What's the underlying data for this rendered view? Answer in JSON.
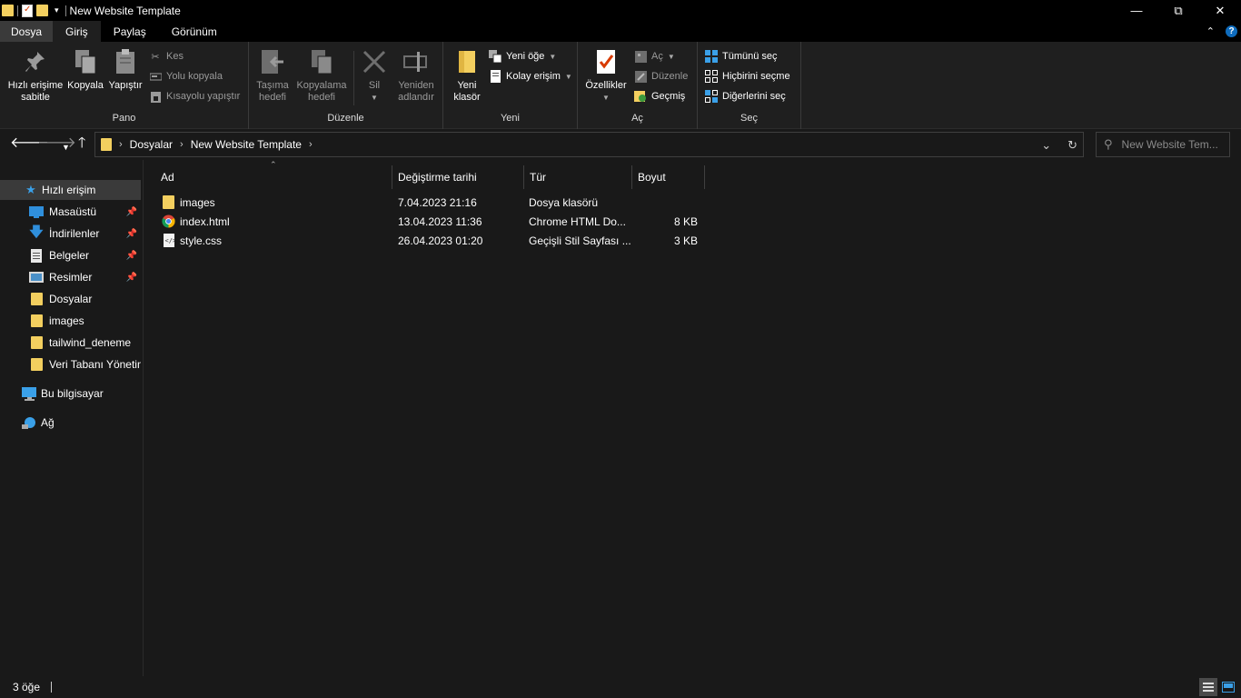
{
  "window": {
    "title": "New Website Template"
  },
  "ribbon_tabs": [
    "Dosya",
    "Giriş",
    "Paylaş",
    "Görünüm"
  ],
  "ribbon": {
    "pano": {
      "label": "Pano",
      "pin": "Hızlı erişime sabitle",
      "copy": "Kopyala",
      "paste": "Yapıştır",
      "cut": "Kes",
      "copy_path": "Yolu kopyala",
      "paste_shortcut": "Kısayolu yapıştır"
    },
    "duzenle": {
      "label": "Düzenle",
      "move_to": "Taşıma hedefi",
      "copy_to": "Kopyalama hedefi",
      "delete": "Sil",
      "rename": "Yeniden adlandır"
    },
    "yeni": {
      "label": "Yeni",
      "new_folder": "Yeni klasör",
      "new_item": "Yeni öğe",
      "easy_access": "Kolay erişim"
    },
    "ac": {
      "label": "Aç",
      "properties": "Özellikler",
      "open": "Aç",
      "edit": "Düzenle",
      "history": "Geçmiş"
    },
    "sec": {
      "label": "Seç",
      "select_all": "Tümünü seç",
      "select_none": "Hiçbirini seçme",
      "invert": "Diğerlerini seç"
    }
  },
  "address": {
    "crumbs": [
      "Dosyalar",
      "New Website Template"
    ],
    "search_placeholder": "New Website Tem..."
  },
  "nav": {
    "quick_access": "Hızlı erişim",
    "items": [
      {
        "label": "Masaüstü",
        "pinned": true
      },
      {
        "label": "İndirilenler",
        "pinned": true
      },
      {
        "label": "Belgeler",
        "pinned": true
      },
      {
        "label": "Resimler",
        "pinned": true
      },
      {
        "label": "Dosyalar",
        "pinned": false
      },
      {
        "label": "images",
        "pinned": false
      },
      {
        "label": "tailwind_deneme",
        "pinned": false
      },
      {
        "label": "Veri Tabanı Yönetim",
        "pinned": false
      }
    ],
    "this_pc": "Bu bilgisayar",
    "network": "Ağ"
  },
  "columns": {
    "name": "Ad",
    "modified": "Değiştirme tarihi",
    "type": "Tür",
    "size": "Boyut"
  },
  "files": [
    {
      "name": "images",
      "modified": "7.04.2023 21:16",
      "type": "Dosya klasörü",
      "size": "",
      "icon": "folder-icon"
    },
    {
      "name": "index.html",
      "modified": "13.04.2023 11:36",
      "type": "Chrome HTML Do...",
      "size": "8 KB",
      "icon": "chrome-icon"
    },
    {
      "name": "style.css",
      "modified": "26.04.2023 01:20",
      "type": "Geçişli Stil Sayfası ...",
      "size": "3 KB",
      "icon": "css-file-icon"
    }
  ],
  "status": {
    "item_count": "3 öğe"
  },
  "colors": {
    "background": "#191919",
    "titlebar": "#000000",
    "folder": "#f3cf5f",
    "accent": "#0f6cbd"
  }
}
